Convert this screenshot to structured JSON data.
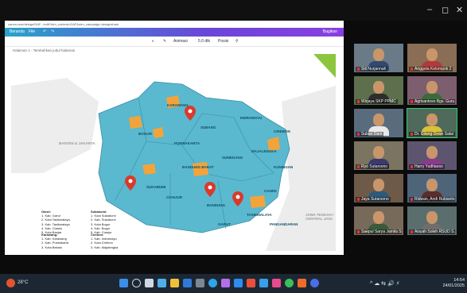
{
  "window": {
    "minimize": "–",
    "maximize": "◻",
    "close": "✕"
  },
  "share": {
    "url": "canva.com/design/DAF.../edit?utm_content=DAF&utm_campaign=designshare",
    "canva": {
      "home": "Beranda",
      "file": "File",
      "share_label": "Bagikan"
    },
    "toolbar": {
      "animation": "Animasi",
      "position": "Posisi",
      "duration": "5.0 dtk"
    },
    "page_label": "Halaman 1 - Tambahkan judul halaman"
  },
  "map": {
    "sea_label": "LAUT JAWA",
    "regions": {
      "banten": "BANTEN & JAKARTA",
      "indramayu": "INDRAMAYU",
      "cirebon": "CIREBON",
      "majalengka": "MAJALENGKA",
      "sumedang": "SUMEDANG",
      "purwakarta": "PURWAKARTA",
      "karawang": "KARAWANG",
      "subang": "SUBANG",
      "bandung": "BANDUNG",
      "bandung_barat": "BANDUNG BARAT",
      "sukabumi": "SUKABUMI",
      "cianjur": "CIANJUR",
      "bogor": "BOGOR",
      "garut": "GARUT",
      "tasikmalaya": "TASIKMALAYA",
      "ciamis": "CIAMIS",
      "pangandaran": "PANGANDARAN",
      "kuningan": "KUNINGAN",
      "banjar": "BANJAR",
      "central_java": "JAWA TENGAH / CENTRAL JAVA"
    },
    "accent_colors": {
      "province": "#5ab8cf",
      "highlight": "#f2a43a",
      "border": "#3c8fa6",
      "pin": "#d93a2b",
      "sea": "#ffffff",
      "neighbor": "#e9e9e9",
      "grass": "#8cc63e"
    }
  },
  "legend": {
    "g1": {
      "title": "Garut:",
      "items": [
        "1. Kab. Garut",
        "2. Kota Tasikmalaya",
        "3. Kab. Tasikmalaya",
        "4. Kab. Ciamis",
        "5. Kota Banjar"
      ]
    },
    "g2": {
      "title": "Sukabumi:",
      "items": [
        "1. Kota Sukabumi",
        "2. Kab. Sukabumi",
        "3. Kota Bogor",
        "4. Kab. Bogor",
        "5. Kab. Cianjur"
      ]
    },
    "g3": {
      "title": "Karawang:",
      "items": [
        "1. Kab. Karawang",
        "2. Kab. Purwakarta",
        "3. Kota Bekasi",
        "4. Kab. Bekasi",
        "5. Kab. Subang",
        "6. Kota Depok"
      ]
    },
    "g4": {
      "title": "Cirebon:",
      "items": [
        "1. Kab. Indramayu",
        "2. Kota Cirebon",
        "3. Kab. Majalengka",
        "4. Kab. Sumedang",
        "5. Kota Cirebon",
        "6. Kab. Cirebon"
      ]
    }
  },
  "participants": [
    {
      "name": "Siti Nurjannah"
    },
    {
      "name": "Anggota Kelompok 2"
    },
    {
      "name": "Wirjaya SKP PPMC"
    },
    {
      "name": "Agrisantoso Bgs. Guru"
    },
    {
      "name": "Suban Dani"
    },
    {
      "name": "Dr. Gilang Dewo Salai"
    },
    {
      "name": "Ryo Sutarsono"
    },
    {
      "name": "Harry Yudhiarso"
    },
    {
      "name": "Jaya Sutarsono"
    },
    {
      "name": "Ridwan, Andi Rubianto"
    },
    {
      "name": "Saepul Sarya Jamila Sa..."
    },
    {
      "name": "Aisyah Soleh RSUD S..."
    }
  ],
  "taskbar": {
    "weather": "28°C",
    "tray": "^  ☁  ⇆  🔊  ⚡",
    "time": "14:54",
    "date": "24/01/2025"
  }
}
